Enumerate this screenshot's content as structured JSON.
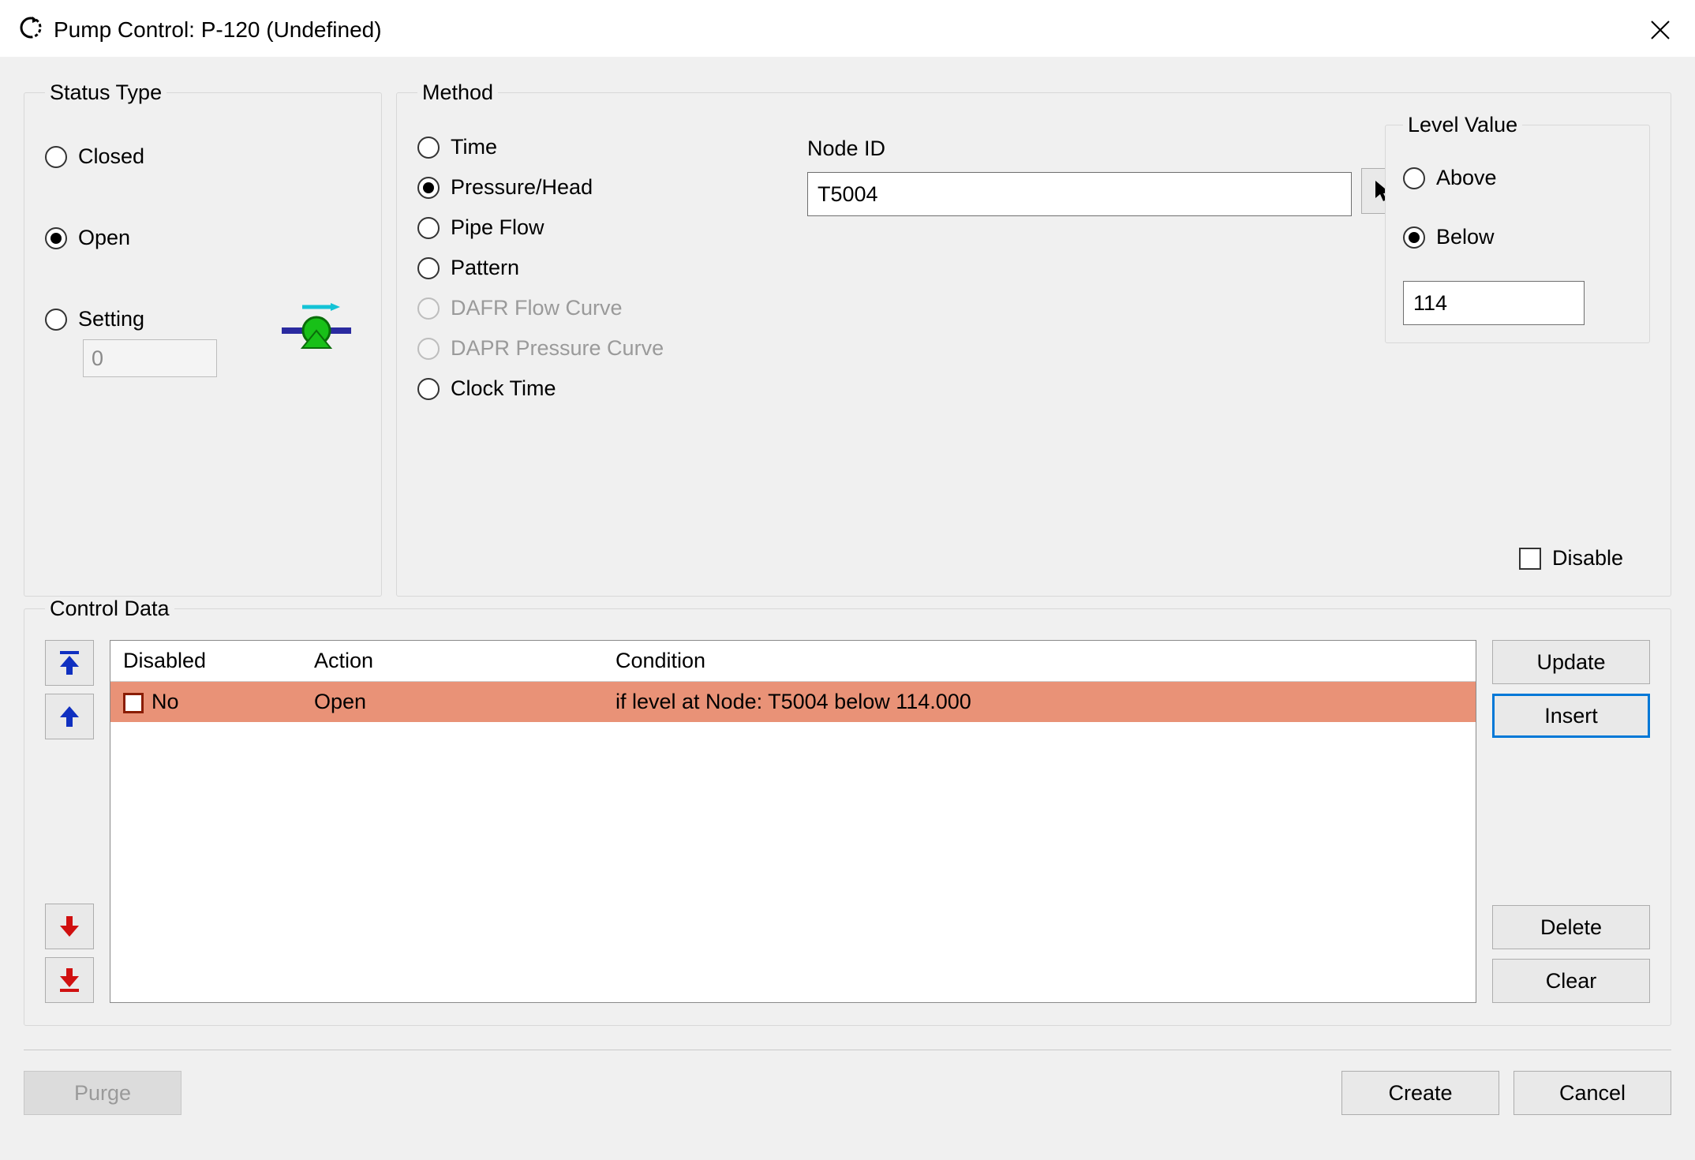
{
  "title": "Pump Control: P-120 (Undefined)",
  "status_type": {
    "legend": "Status Type",
    "closed": "Closed",
    "open": "Open",
    "setting": "Setting",
    "setting_value": "0",
    "selected": "open"
  },
  "method": {
    "legend": "Method",
    "options": {
      "time": "Time",
      "pressure_head": "Pressure/Head",
      "pipe_flow": "Pipe Flow",
      "pattern": "Pattern",
      "dafr": "DAFR Flow Curve",
      "dapr": "DAPR Pressure Curve",
      "clock_time": "Clock Time"
    },
    "selected": "pressure_head",
    "node_id_label": "Node ID",
    "node_id_value": "T5004"
  },
  "level_value": {
    "legend": "Level Value",
    "above": "Above",
    "below": "Below",
    "selected": "below",
    "value": "114"
  },
  "disable_label": "Disable",
  "control_data": {
    "legend": "Control Data",
    "headers": {
      "disabled": "Disabled",
      "action": "Action",
      "condition": "Condition"
    },
    "rows": [
      {
        "disabled": "No",
        "action": "Open",
        "condition": "if level at Node: T5004 below 114.000",
        "selected": true
      }
    ],
    "buttons": {
      "update": "Update",
      "insert": "Insert",
      "delete": "Delete",
      "clear": "Clear"
    }
  },
  "footer": {
    "purge": "Purge",
    "create": "Create",
    "cancel": "Cancel"
  }
}
